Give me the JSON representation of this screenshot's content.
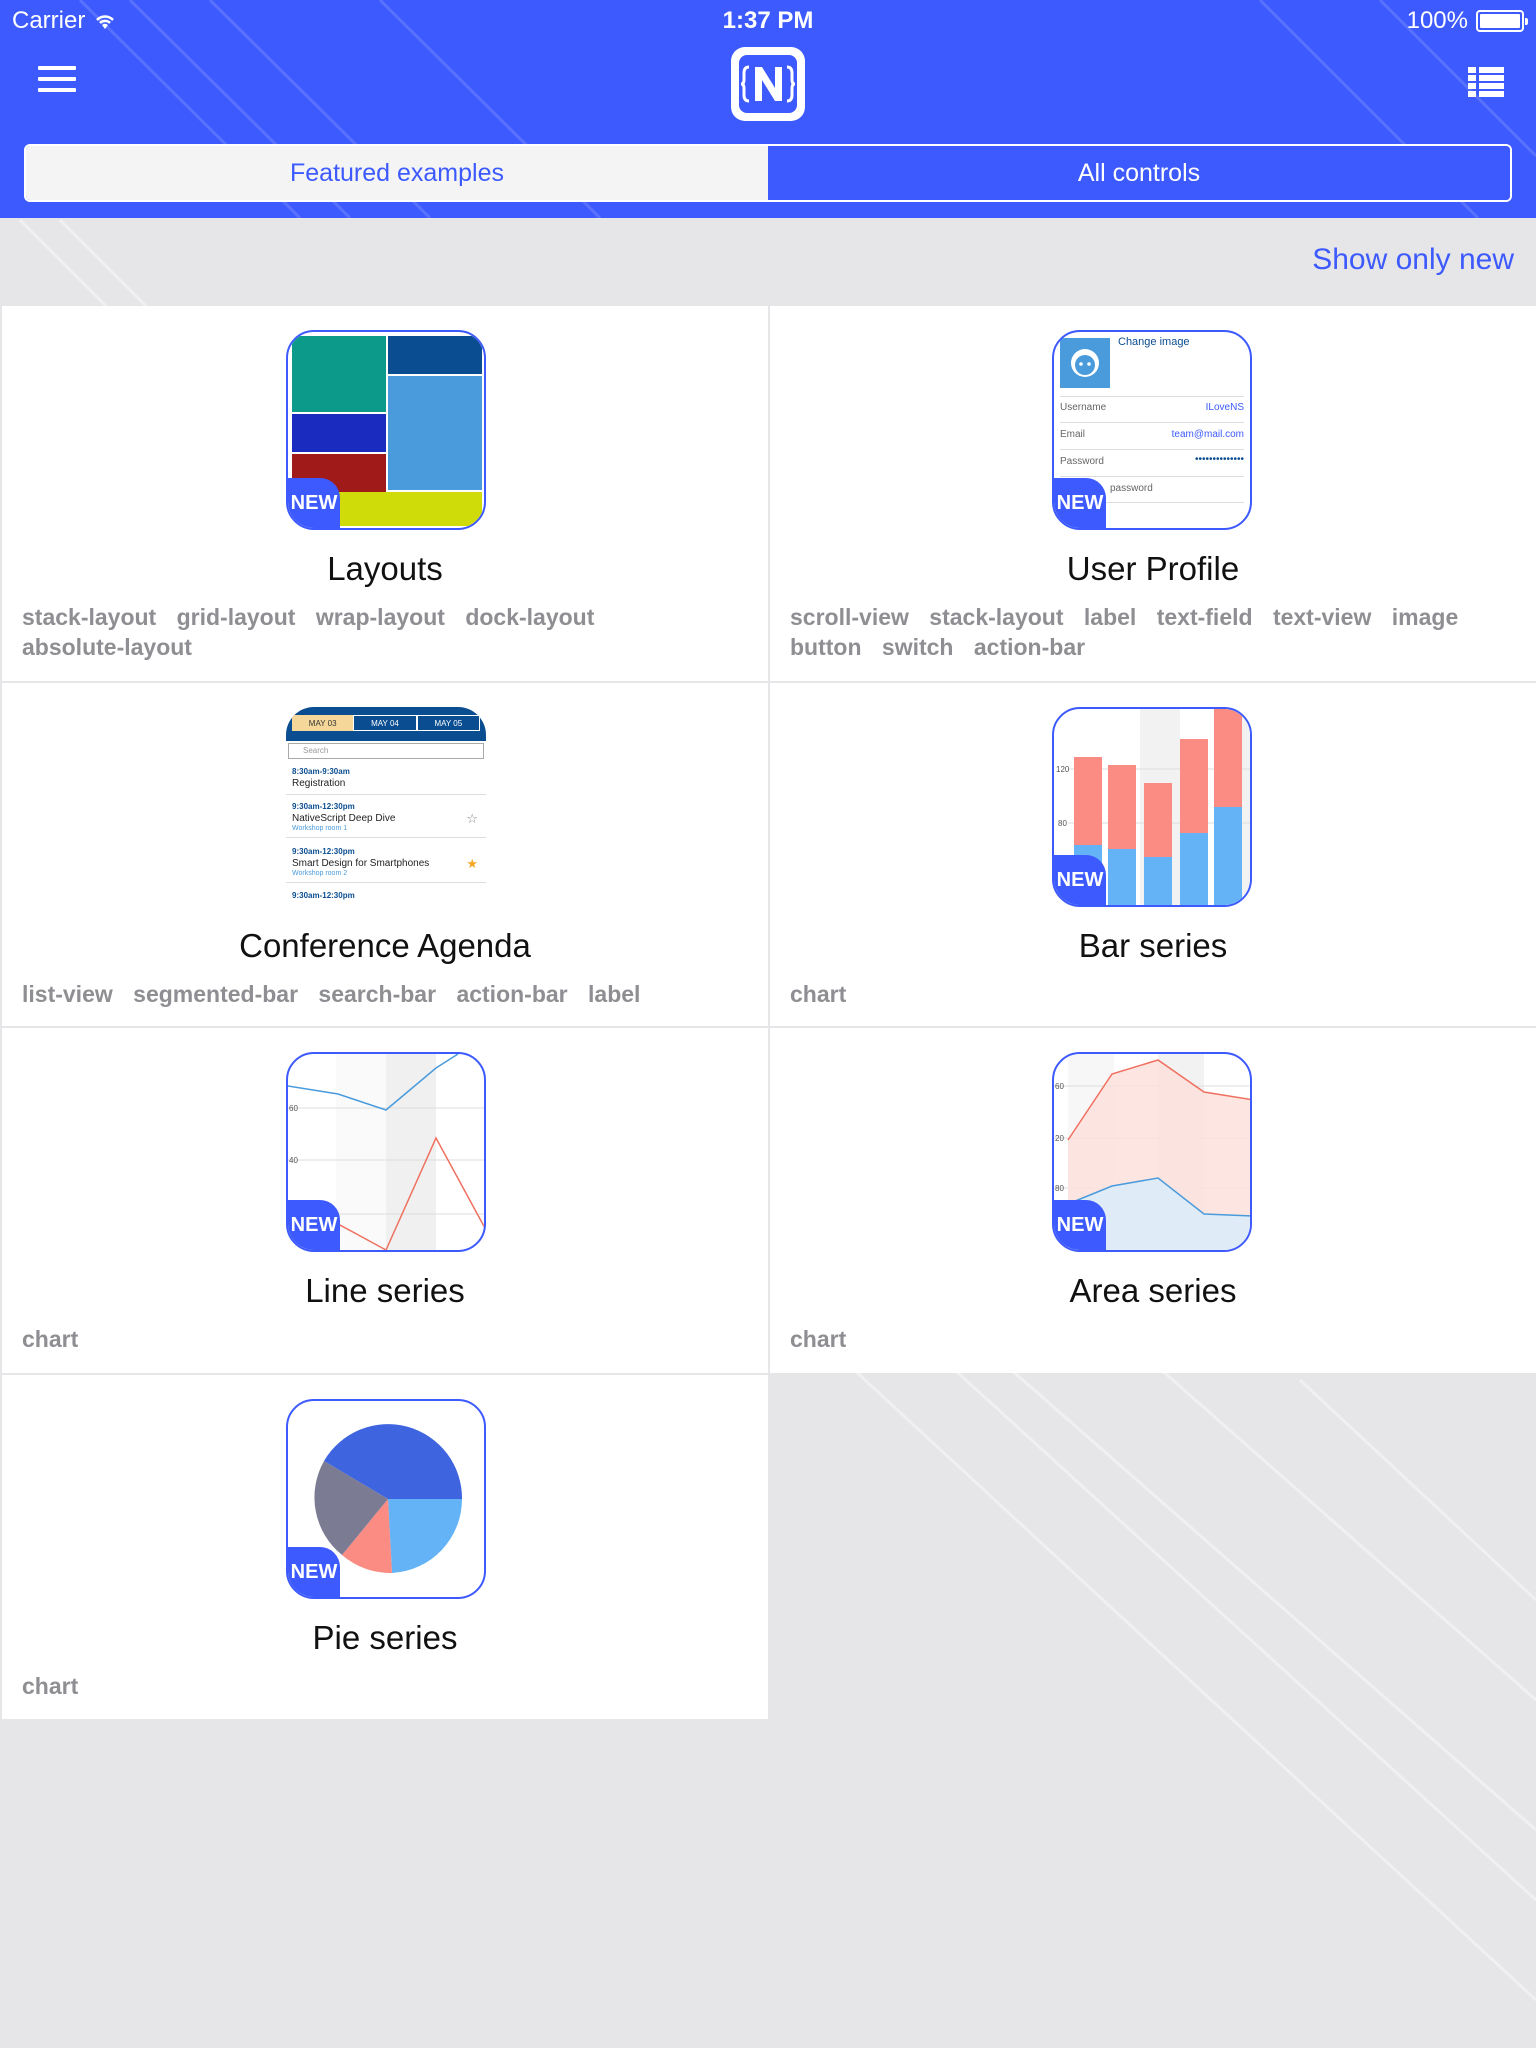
{
  "status_bar": {
    "carrier": "Carrier",
    "time": "1:37 PM",
    "battery": "100%"
  },
  "header": {
    "menu_icon": "hamburger-menu-icon",
    "logo_icon": "nativescript-logo-icon",
    "list_icon": "list-view-icon",
    "tabs": [
      {
        "label": "Featured examples",
        "selected": true
      },
      {
        "label": "All controls",
        "selected": false
      }
    ]
  },
  "filter": {
    "show_only_new": "Show only new"
  },
  "colors": {
    "accent": "#3d5afe",
    "background": "#e6e6e8",
    "tag": "#8e8e93"
  },
  "cards": [
    {
      "title": "Layouts",
      "is_new": true,
      "badge": "NEW",
      "tags": [
        "stack-layout",
        "grid-layout",
        "wrap-layout",
        "dock-layout",
        "absolute-layout"
      ]
    },
    {
      "title": "User Profile",
      "is_new": true,
      "badge": "NEW",
      "tags": [
        "scroll-view",
        "stack-layout",
        "label",
        "text-field",
        "text-view",
        "image",
        "button",
        "switch",
        "action-bar"
      ],
      "thumb": {
        "change_image": "Change image",
        "username_label": "Username",
        "username_value": "ILoveNS",
        "email_label": "Email",
        "email_value": "team@mail.com",
        "password_label": "Password",
        "password_value": "••••••••••••••",
        "confirm_label": "password"
      }
    },
    {
      "title": "Conference Agenda",
      "is_new": false,
      "badge": "",
      "tags": [
        "list-view",
        "segmented-bar",
        "search-bar",
        "action-bar",
        "label"
      ],
      "thumb": {
        "tabs": [
          "MAY 03",
          "MAY 04",
          "MAY 05"
        ],
        "search": "Search",
        "items": [
          {
            "time": "8:30am-9:30am",
            "title": "Registration",
            "room": ""
          },
          {
            "time": "9:30am-12:30pm",
            "title": "NativeScript Deep Dive",
            "room": "Workshop room 1"
          },
          {
            "time": "9:30am-12:30pm",
            "title": "Smart Design for Smartphones",
            "room": "Workshop room 2"
          },
          {
            "time": "9:30am-12:30pm",
            "title": "",
            "room": ""
          }
        ]
      }
    },
    {
      "title": "Bar series",
      "is_new": true,
      "badge": "NEW",
      "tags": [
        "chart"
      ],
      "thumb": {
        "y_ticks": [
          "120",
          "80"
        ]
      }
    },
    {
      "title": "Line series",
      "is_new": true,
      "badge": "NEW",
      "tags": [
        "chart"
      ],
      "thumb": {
        "y_ticks": [
          "60",
          "40"
        ]
      }
    },
    {
      "title": "Area series",
      "is_new": true,
      "badge": "NEW",
      "tags": [
        "chart"
      ],
      "thumb": {
        "y_ticks": [
          "60",
          "20",
          "80"
        ]
      }
    },
    {
      "title": "Pie series",
      "is_new": true,
      "badge": "NEW",
      "tags": [
        "chart"
      ]
    }
  ]
}
